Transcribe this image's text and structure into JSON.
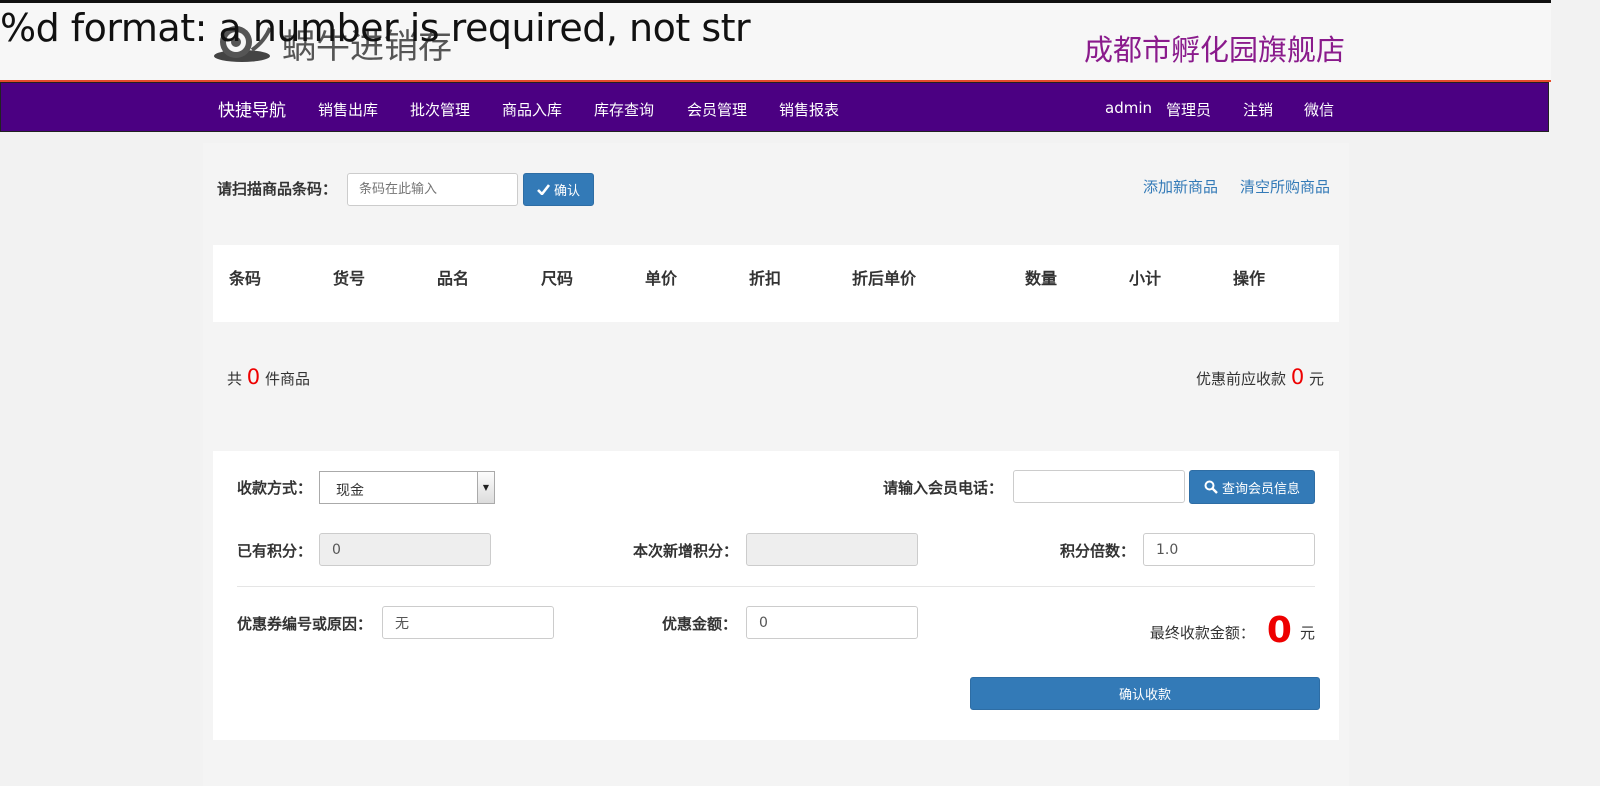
{
  "error_banner": "%d format: a number is required, not str",
  "logo": {
    "text": "蜗牛进销存",
    "icon": "snail-icon"
  },
  "store_name": "成都市孵化园旗舰店",
  "nav": {
    "brand": "快捷导航",
    "items": [
      "销售出库",
      "批次管理",
      "商品入库",
      "库存查询",
      "会员管理",
      "销售报表"
    ],
    "user": "admin",
    "role": "管理员",
    "logout": "注销",
    "wechat": "微信"
  },
  "scan": {
    "label": "请扫描商品条码：",
    "placeholder": "条码在此输入",
    "confirm": "确认",
    "confirm_icon": "check-icon",
    "add_product": "添加新商品",
    "clear_cart": "清空所购商品"
  },
  "cart_table": {
    "columns": [
      "条码",
      "货号",
      "品名",
      "尺码",
      "单价",
      "折扣",
      "折后单价",
      "数量",
      "小计",
      "操作"
    ],
    "rows": []
  },
  "summary": {
    "prefix": "共",
    "count": "0",
    "suffix": "件商品",
    "pre_discount_label": "优惠前应收款",
    "pre_discount_amount": "0",
    "currency": "元"
  },
  "payment": {
    "method_label": "收款方式：",
    "method_value": "现金",
    "member_phone_label": "请输入会员电话：",
    "member_phone_value": "",
    "query_member": "查询会员信息",
    "query_icon": "search-icon",
    "existing_points_label": "已有积分：",
    "existing_points": "0",
    "new_points_label": "本次新增积分：",
    "new_points": "",
    "points_multiplier_label": "积分倍数：",
    "points_multiplier": "1.0",
    "coupon_label": "优惠券编号或原因：",
    "coupon_value": "无",
    "discount_amount_label": "优惠金额：",
    "discount_amount": "0",
    "final_label": "最终收款金额：",
    "final_amount": "0",
    "currency": "元",
    "confirm_payment": "确认收款"
  },
  "colors": {
    "nav_bg": "#4b0082",
    "accent_red": "#e74b2b",
    "store_name": "#8a1b8c",
    "primary_button": "#337ab7",
    "amount_red": "#ee0000"
  }
}
